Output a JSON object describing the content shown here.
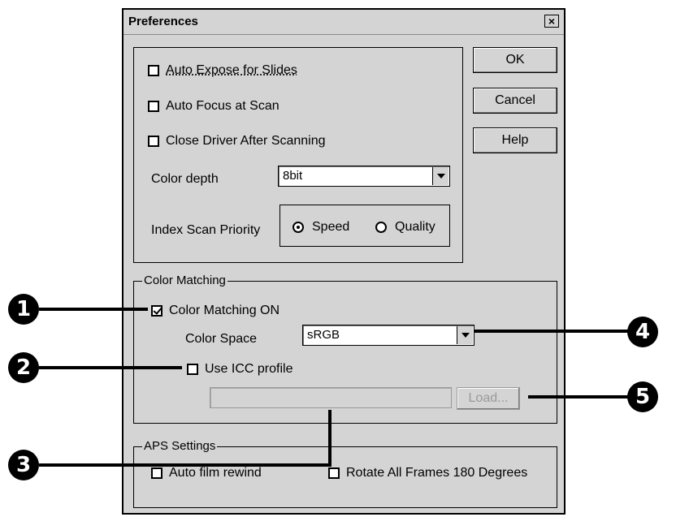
{
  "window": {
    "title": "Preferences",
    "close_label": "×"
  },
  "buttons": {
    "ok": "OK",
    "cancel": "Cancel",
    "help": "Help",
    "load": "Load..."
  },
  "general": {
    "auto_expose": {
      "label": "Auto Expose for Slides",
      "checked": false
    },
    "auto_focus": {
      "label": "Auto Focus at Scan",
      "checked": false
    },
    "close_driver": {
      "label": "Close Driver After Scanning",
      "checked": false
    },
    "color_depth_label": "Color depth",
    "color_depth_value": "8bit",
    "index_scan_label": "Index Scan Priority",
    "index_scan_options": [
      "Speed",
      "Quality"
    ],
    "index_scan_selected": "Speed"
  },
  "color_matching": {
    "legend": "Color Matching",
    "color_matching_on": {
      "label": "Color Matching ON",
      "checked": true
    },
    "color_space_label": "Color Space",
    "color_space_value": "sRGB",
    "use_icc": {
      "label": "Use ICC profile",
      "checked": false
    },
    "icc_path": ""
  },
  "aps": {
    "legend": "APS Settings",
    "auto_rewind": {
      "label": "Auto film rewind",
      "checked": false
    },
    "rotate_all": {
      "label": "Rotate All Frames 180 Degrees",
      "checked": false
    }
  },
  "callouts": [
    "1",
    "2",
    "3",
    "4",
    "5"
  ],
  "icons": {
    "dropdown": "triangle-down-icon",
    "close": "close-icon"
  }
}
